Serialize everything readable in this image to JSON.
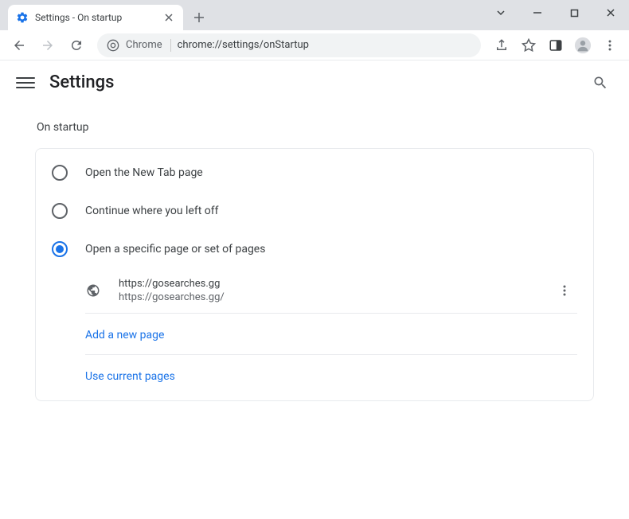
{
  "tab": {
    "title": "Settings - On startup"
  },
  "omnibox": {
    "prefix": "Chrome",
    "url": "chrome://settings/onStartup"
  },
  "header": {
    "title": "Settings"
  },
  "section": {
    "title": "On startup",
    "options": [
      {
        "label": "Open the New Tab page",
        "selected": false
      },
      {
        "label": "Continue where you left off",
        "selected": false
      },
      {
        "label": "Open a specific page or set of pages",
        "selected": true
      }
    ],
    "pages": [
      {
        "title": "https://gosearches.gg",
        "url": "https://gosearches.gg/"
      }
    ],
    "add_label": "Add a new page",
    "use_current_label": "Use current pages"
  }
}
